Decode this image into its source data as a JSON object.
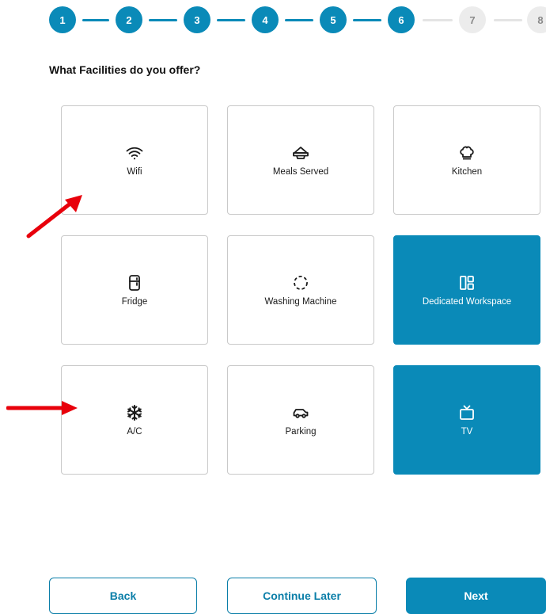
{
  "stepper": {
    "steps": [
      {
        "label": "1",
        "state": "done"
      },
      {
        "label": "2",
        "state": "done"
      },
      {
        "label": "3",
        "state": "done"
      },
      {
        "label": "4",
        "state": "done"
      },
      {
        "label": "5",
        "state": "done"
      },
      {
        "label": "6",
        "state": "done"
      },
      {
        "label": "7",
        "state": "todo"
      },
      {
        "label": "8",
        "state": "todo"
      }
    ]
  },
  "question": "What Facilities do you offer?",
  "facilities": [
    {
      "label": "Wifi",
      "icon": "wifi-icon",
      "selected": false
    },
    {
      "label": "Meals Served",
      "icon": "meal-tray-icon",
      "selected": false
    },
    {
      "label": "Kitchen",
      "icon": "chef-hat-icon",
      "selected": false
    },
    {
      "label": "Fridge",
      "icon": "fridge-icon",
      "selected": false
    },
    {
      "label": "Washing Machine",
      "icon": "washing-machine-icon",
      "selected": false
    },
    {
      "label": "Dedicated Workspace",
      "icon": "workspace-layout-icon",
      "selected": true
    },
    {
      "label": "A/C",
      "icon": "snowflake-icon",
      "selected": false
    },
    {
      "label": "Parking",
      "icon": "car-icon",
      "selected": false
    },
    {
      "label": "TV",
      "icon": "tv-icon",
      "selected": true
    }
  ],
  "buttons": {
    "back": "Back",
    "continue_later": "Continue Later",
    "next": "Next"
  },
  "colors": {
    "accent": "#0a8ab8",
    "annotation_arrow": "#e8000b"
  }
}
